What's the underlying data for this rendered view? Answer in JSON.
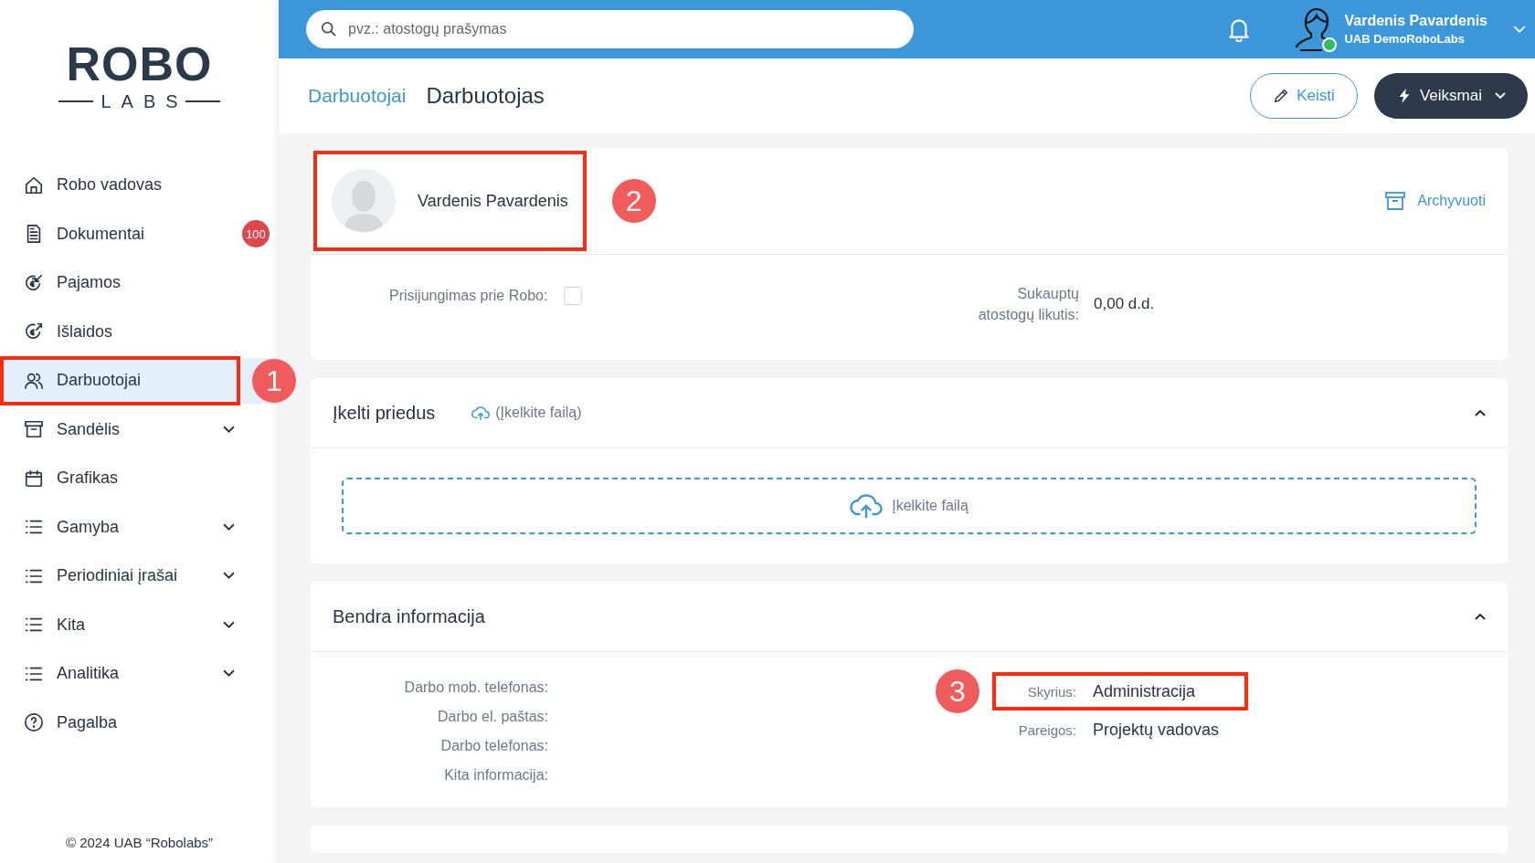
{
  "logo": {
    "top": "ROBO",
    "bottom": "LABS"
  },
  "sidebar": {
    "items": [
      {
        "label": "Robo vadovas",
        "selected": false,
        "expandable": false
      },
      {
        "label": "Dokumentai",
        "selected": false,
        "expandable": false,
        "badge": "100"
      },
      {
        "label": "Pajamos",
        "selected": false,
        "expandable": false
      },
      {
        "label": "Išlaidos",
        "selected": false,
        "expandable": false
      },
      {
        "label": "Darbuotojai",
        "selected": true,
        "expandable": false,
        "callout": "1"
      },
      {
        "label": "Sandėlis",
        "selected": false,
        "expandable": true
      },
      {
        "label": "Grafikas",
        "selected": false,
        "expandable": false
      },
      {
        "label": "Gamyba",
        "selected": false,
        "expandable": true
      },
      {
        "label": "Periodiniai įrašai",
        "selected": false,
        "expandable": true
      },
      {
        "label": "Kita",
        "selected": false,
        "expandable": true
      },
      {
        "label": "Analitika",
        "selected": false,
        "expandable": true
      },
      {
        "label": "Pagalba",
        "selected": false,
        "expandable": false
      }
    ],
    "footer": "© 2024 UAB “Robolabs”"
  },
  "topbar": {
    "search": {
      "placeholder": "pvz.: atostogų prašymas"
    },
    "user": {
      "name": "Vardenis Pavardenis",
      "company": "UAB DemoRoboLabs",
      "online": true
    }
  },
  "breadcrumb": [
    {
      "label": "Darbuotojai",
      "kind": "link"
    },
    {
      "label": "Darbuotojas",
      "kind": "current"
    }
  ],
  "actions": [
    {
      "label": "Keisti",
      "kind": "outline"
    },
    {
      "label": "Veiksmai",
      "kind": "dark"
    }
  ],
  "profile": {
    "name": "Vardenis Pavardenis",
    "callout": "2",
    "archive": "Archyvuoti",
    "login": {
      "label": "Prisijungimas prie Robo:",
      "checked": false
    },
    "leave": {
      "label": "Sukauptų atostogų likutis:",
      "value": "0,00 d.d."
    }
  },
  "attachments": {
    "title": "Įkelti priedus",
    "upload_link": "(Įkelkite failą)",
    "dropzone": "Įkelkite failą",
    "expanded": true
  },
  "general": {
    "title": "Bendra informacija",
    "expanded": true,
    "left_fields": [
      {
        "label": "Darbo mob. telefonas:"
      },
      {
        "label": "Darbo el. paštas:"
      },
      {
        "label": "Darbo telefonas:"
      },
      {
        "label": "Kita informacija:"
      }
    ],
    "right_fields": [
      {
        "label": "Skyrius:",
        "value": "Administracija",
        "callout": "3"
      },
      {
        "label": "Pareigos:",
        "value": "Projektų vadovas"
      }
    ]
  }
}
